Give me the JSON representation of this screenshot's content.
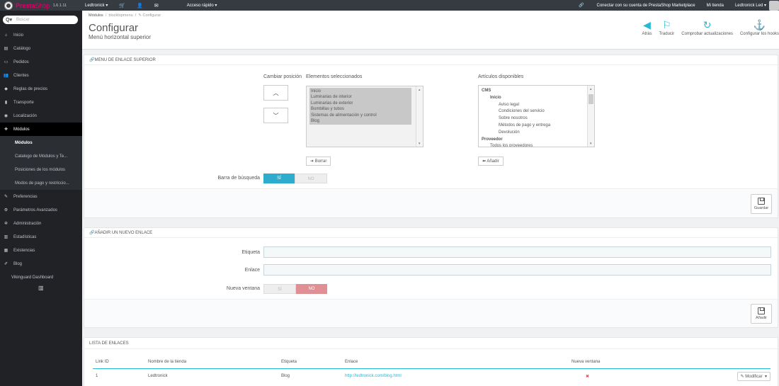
{
  "topbar": {
    "brand1": "Presta",
    "brand2": "Shop",
    "version": "1.6.1.11",
    "shop_menu": "Ledtronick ▾",
    "quick_access": "Acceso rápido ▾",
    "marketplace": "Conectar con su cuenta de PrestaShop Marketplace",
    "my_shop": "Mi tienda",
    "user": "Ledtronick Led ▾"
  },
  "sidebar": {
    "search_placeholder": "Buscar",
    "items": [
      {
        "label": "Inicio",
        "icon": "home-icon"
      },
      {
        "label": "Catálogo",
        "icon": "book-icon"
      },
      {
        "label": "Pedidos",
        "icon": "card-icon"
      },
      {
        "label": "Clientes",
        "icon": "users-icon"
      },
      {
        "label": "Reglas de precios",
        "icon": "tag-icon"
      },
      {
        "label": "Transporte",
        "icon": "truck-icon"
      },
      {
        "label": "Localización",
        "icon": "globe-icon"
      },
      {
        "label": "Módulos",
        "icon": "puzzle-icon"
      },
      {
        "label": "Preferencias",
        "icon": "wrench-icon"
      },
      {
        "label": "Parámetros Avanzados",
        "icon": "cogs-icon"
      },
      {
        "label": "Administración",
        "icon": "cog-icon"
      },
      {
        "label": "Estadísticas",
        "icon": "chart-icon"
      },
      {
        "label": "Existencias",
        "icon": "box-icon"
      },
      {
        "label": "Blog",
        "icon": "edit-icon"
      },
      {
        "label": "Vikinguard Dashboard",
        "icon": ""
      }
    ],
    "subitems": [
      "Módulos",
      "Catalogo de Módulos y Te...",
      "Posiciones de los módulos",
      "Modos de pago y restriccio..."
    ]
  },
  "header": {
    "breadcrumb": [
      "Módulos",
      "blocktopmenu",
      "Configurar"
    ],
    "title": "Configurar",
    "subtitle": "Menú horizontal superior",
    "tools": [
      "Atrás",
      "Traducir",
      "Comprobar actualizaciones",
      "Configurar los hooks"
    ]
  },
  "menu_panel": {
    "heading": "MENU DE ENLACE SUPERIOR",
    "change_position": "Cambiar posición",
    "selected_label": "Elementos seleccionados",
    "available_label": "Artículos disponibles",
    "selected_items": [
      "Inicio",
      "Luminarias de interior",
      "Luminarias de exterior",
      "Bombillas y tubos",
      "Sistemas de alimentación y control",
      "Blog"
    ],
    "available_items": [
      {
        "text": "CMS",
        "level": 0,
        "bold": true
      },
      {
        "text": "Inicio",
        "level": 1,
        "bold": true
      },
      {
        "text": "Aviso legal",
        "level": 2,
        "bold": false
      },
      {
        "text": "Condiciones del servicio",
        "level": 2,
        "bold": false
      },
      {
        "text": "Sobre nosotros",
        "level": 2,
        "bold": false
      },
      {
        "text": "Métodos de pago y entrega",
        "level": 2,
        "bold": false
      },
      {
        "text": "Devolución",
        "level": 2,
        "bold": false
      },
      {
        "text": "Proveedor",
        "level": 0,
        "bold": true
      },
      {
        "text": "Todos los proveedores",
        "level": 1,
        "bold": false
      }
    ],
    "remove_button": "Borrar",
    "add_button": "Añadir",
    "search_bar_label": "Barra de búsqueda",
    "toggle_yes": "SÍ",
    "toggle_no": "NO",
    "save": "Guardar"
  },
  "new_link_panel": {
    "heading": "AÑADIR UN NUEVO ENLACE",
    "label_field": "Etiqueta",
    "link_field": "Enlace",
    "new_window": "Nueva ventana",
    "toggle_yes": "SÍ",
    "toggle_no": "NO",
    "add": "Añadir"
  },
  "links_list": {
    "heading": "LISTA DE ENLACES",
    "columns": [
      "Link ID",
      "Nombre de la tienda",
      "Etiqueta",
      "Enlace",
      "Nueva ventana"
    ],
    "rows": [
      {
        "id": "1",
        "shop": "Ledtronick",
        "label": "Blog",
        "link": "http://ledtronick.com/blog.html",
        "new_window": "✖"
      }
    ],
    "modify": "Modificar"
  },
  "colors": {
    "accent": "#25b9d7",
    "topbar": "#363a41",
    "sidebar": "#202226",
    "danger": "#e08f95",
    "brand": "#df0067"
  }
}
